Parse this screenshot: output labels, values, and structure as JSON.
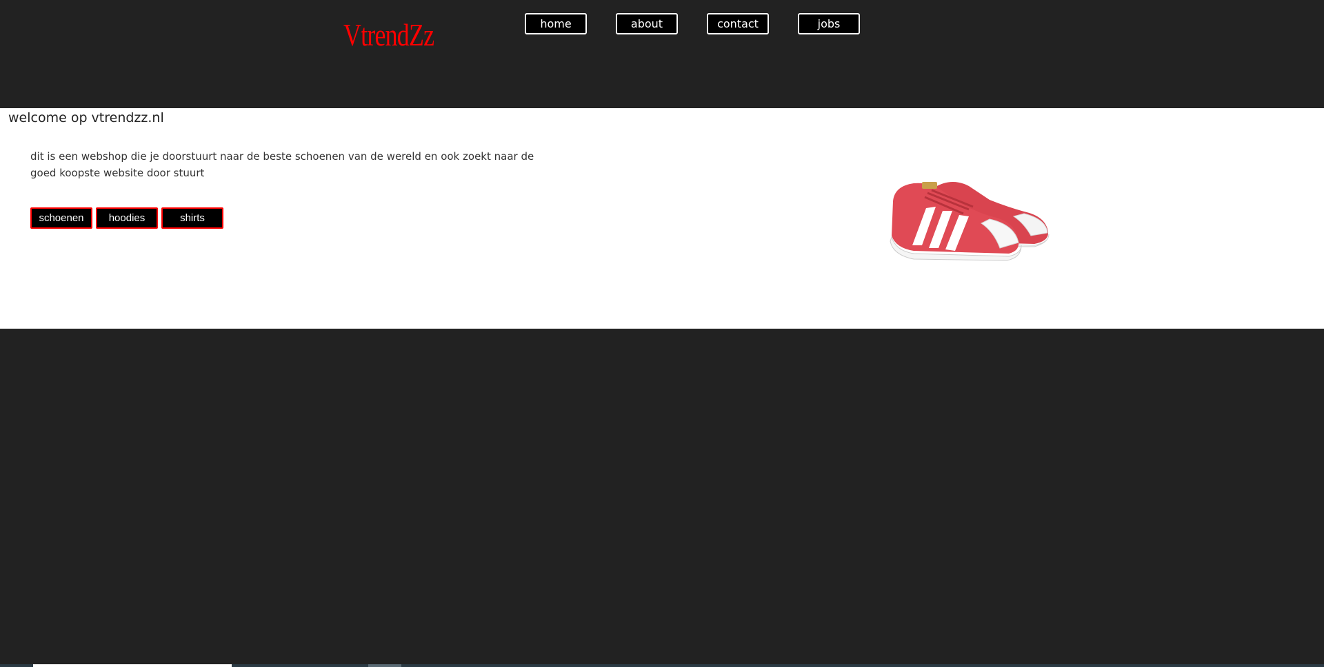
{
  "header": {
    "logo": "VtrendZz",
    "nav": [
      {
        "label": "home"
      },
      {
        "label": "about"
      },
      {
        "label": "contact"
      },
      {
        "label": "jobs"
      }
    ]
  },
  "main": {
    "welcome": "welcome op vtrendzz.nl",
    "description": "dit is een webshop die je doorstuurt naar de beste schoenen van de wereld en ook zoekt naar de goed koopste website door stuurt",
    "categories": [
      {
        "label": "schoenen"
      },
      {
        "label": "hoodies"
      },
      {
        "label": "shirts"
      }
    ]
  },
  "colors": {
    "background": "#222222",
    "logo": "#ff0000",
    "content_bg": "#ffffff",
    "category_border": "#ff0000"
  }
}
